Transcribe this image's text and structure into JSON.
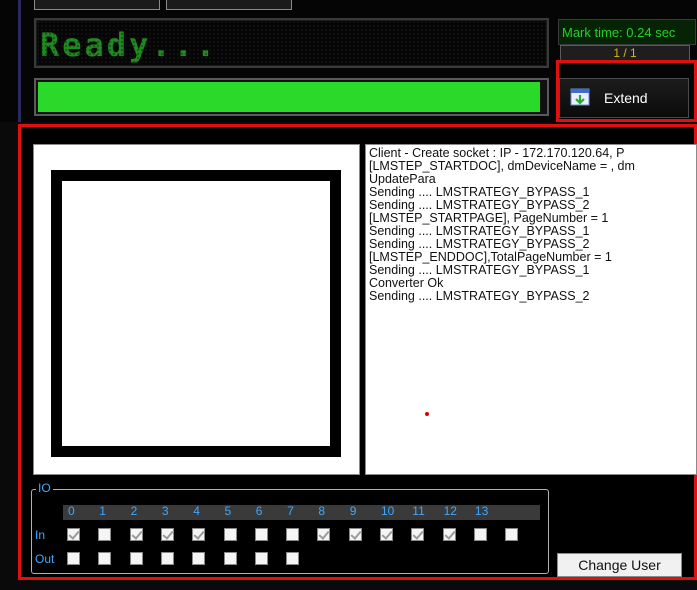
{
  "status": {
    "display_text": "Ready...",
    "progress_fraction": 0.99
  },
  "mark_time": "Mark time: 0.24 sec",
  "page_counter": "1 / 1",
  "extend_button": {
    "label": "Extend",
    "icon": "extend-window-icon"
  },
  "log_lines": [
    "Client - Create socket : IP - 172.170.120.64, P",
    "[LMSTEP_STARTDOC], dmDeviceName = , dm",
    "UpdatePara",
    "Sending .... LMSTRATEGY_BYPASS_1",
    "Sending .... LMSTRATEGY_BYPASS_2",
    "[LMSTEP_STARTPAGE], PageNumber = 1",
    "Sending .... LMSTRATEGY_BYPASS_1",
    "Sending .... LMSTRATEGY_BYPASS_2",
    "[LMSTEP_ENDDOC],TotalPageNumber = 1",
    "Sending .... LMSTRATEGY_BYPASS_1",
    "Converter Ok",
    "Sending .... LMSTRATEGY_BYPASS_2"
  ],
  "io": {
    "legend": "IO",
    "numbers": [
      "0",
      "1",
      "2",
      "3",
      "4",
      "5",
      "6",
      "7",
      "8",
      "9",
      "10",
      "11",
      "12",
      "13"
    ],
    "in_label": "In",
    "out_label": "Out",
    "in_checked": [
      true,
      false,
      true,
      true,
      true,
      false,
      false,
      false,
      true,
      true,
      true,
      true,
      true,
      false,
      false
    ],
    "out_count": 8
  },
  "change_user_label": "Change User",
  "colors": {
    "accent_red": "#e01010",
    "progress_green": "#2bd92b",
    "status_green": "#1f8a1f",
    "io_blue": "#3fa7ff"
  }
}
